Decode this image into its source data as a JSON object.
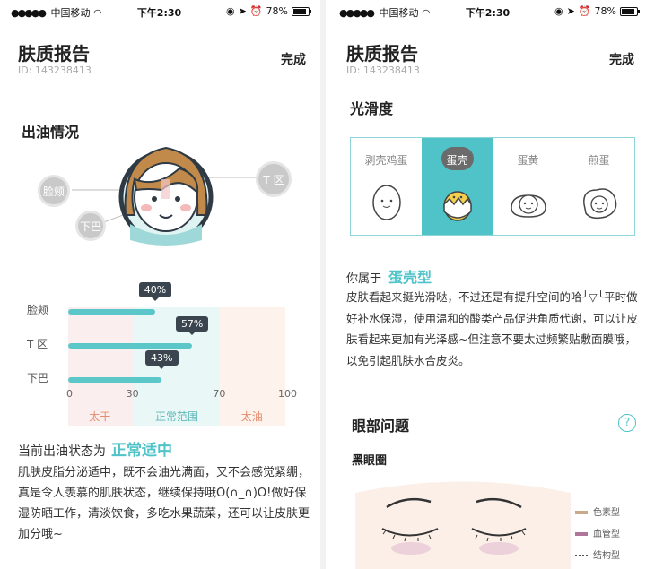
{
  "status_bar": {
    "carrier": "中国移动",
    "time": "下午2:30",
    "battery": "78%",
    "battery_level": 0.78
  },
  "header": {
    "title": "肤质报告",
    "id": "ID: 143238413",
    "done": "完成"
  },
  "oil": {
    "title": "出油情况",
    "bubbles": {
      "cheek": "脸颊",
      "tzone": "T 区",
      "chin": "下巴"
    },
    "chart_data": {
      "type": "bar",
      "categories": [
        "脸颊",
        "T 区",
        "下巴"
      ],
      "values": [
        40,
        57,
        43
      ],
      "value_labels": [
        "40%",
        "57%",
        "43%"
      ],
      "xlim": [
        0,
        100
      ],
      "ticks": [
        "0",
        "30",
        "70",
        "100"
      ],
      "tick_values": [
        0,
        30,
        70,
        100
      ],
      "zones": [
        "太干",
        "正常范围",
        "太油"
      ],
      "colors": {
        "bar": "#5cc7c9",
        "dry": "#fbeeee",
        "normal": "#e9f7f7",
        "oily": "#fdf3ec",
        "dry_text": "#e38c6f",
        "normal_text": "#5fb8b8",
        "oily_text": "#e38c6f"
      }
    },
    "status_prefix": "当前出油状态为",
    "status_value": "正常适中",
    "description": "肌肤皮脂分泌适中，既不会油光满面，又不会感觉紧绷，真是令人羡慕的肌肤状态，继续保持哦O(∩_∩)O!做好保湿防晒工作，清淡饮食，多吃水果蔬菜，还可以让皮肤更加分哦~"
  },
  "smooth": {
    "title": "光滑度",
    "eggs": [
      {
        "label": "剥壳鸡蛋",
        "icon": "peeled-egg-icon",
        "selected": false
      },
      {
        "label": "蛋壳",
        "icon": "eggshell-icon",
        "selected": true
      },
      {
        "label": "蛋黄",
        "icon": "egg-yolk-icon",
        "selected": false
      },
      {
        "label": "煎蛋",
        "icon": "fried-egg-icon",
        "selected": false
      }
    ],
    "type_prefix": "你属于",
    "type_value": "蛋壳型",
    "description": "皮肤看起来挺光滑哒，不过还是有提升空间的哈╯▽╰平时做好补水保湿，使用温和的酸类产品促进角质代谢，可以让皮肤看起来更加有光泽感~但注意不要太过频繁贴敷面膜哦，以免引起肌肤水合皮炎。"
  },
  "eye": {
    "title": "眼部问题",
    "help": "?",
    "subtitle": "黑眼圈",
    "legend": [
      "色素型",
      "血管型",
      "结构型"
    ],
    "legend_colors": [
      "#c9a98a",
      "#b0769a",
      "#555555"
    ],
    "accent": "#4fc3c8"
  }
}
